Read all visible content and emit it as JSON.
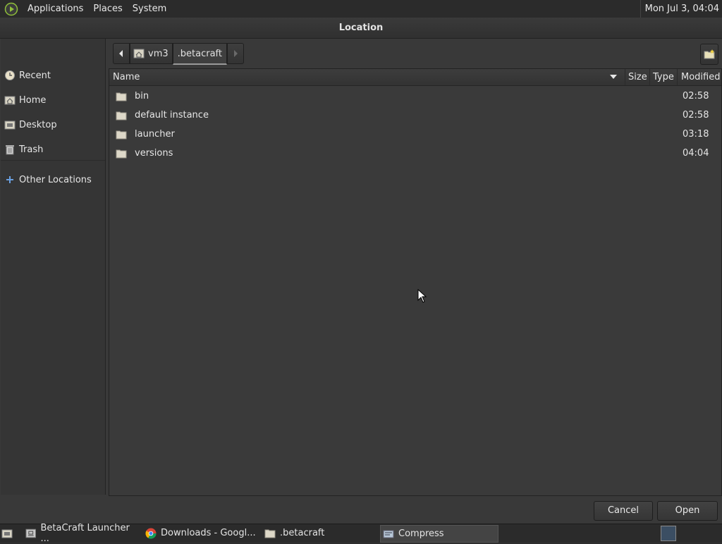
{
  "top_panel": {
    "menus": [
      "Applications",
      "Places",
      "System"
    ],
    "clock": "Mon Jul  3, 04:04"
  },
  "dialog": {
    "title": "Location",
    "sidebar": {
      "items": [
        {
          "label": "Recent",
          "icon": "recent-icon"
        },
        {
          "label": "Home",
          "icon": "home-icon"
        },
        {
          "label": "Desktop",
          "icon": "desktop-icon"
        },
        {
          "label": "Trash",
          "icon": "trash-icon"
        },
        {
          "label": "Other Locations",
          "icon": "plus-icon"
        }
      ]
    },
    "pathbar": {
      "segments": [
        "vm3",
        ".betacraft"
      ],
      "current": ".betacraft"
    },
    "columns": {
      "name": "Name",
      "size": "Size",
      "type": "Type",
      "modified": "Modified"
    },
    "files": [
      {
        "name": "bin",
        "size": "",
        "type": "",
        "modified": "02:58"
      },
      {
        "name": "default instance",
        "size": "",
        "type": "",
        "modified": "02:58"
      },
      {
        "name": "launcher",
        "size": "",
        "type": "",
        "modified": "03:18"
      },
      {
        "name": "versions",
        "size": "",
        "type": "",
        "modified": "04:04"
      }
    ],
    "buttons": {
      "cancel": "Cancel",
      "open": "Open"
    }
  },
  "taskbar": {
    "tasks": [
      {
        "label": "BetaCraft Launcher ...",
        "icon": "java-icon",
        "active": false
      },
      {
        "label": "Downloads - Googl...",
        "icon": "chrome-icon",
        "active": false
      },
      {
        "label": ".betacraft",
        "icon": "folder-icon",
        "active": false
      },
      {
        "label": "Compress",
        "icon": "archive-icon",
        "active": true
      }
    ]
  },
  "colors": {
    "background": "#393939",
    "panel": "#2b2b2b",
    "text": "#e6e6e6"
  }
}
